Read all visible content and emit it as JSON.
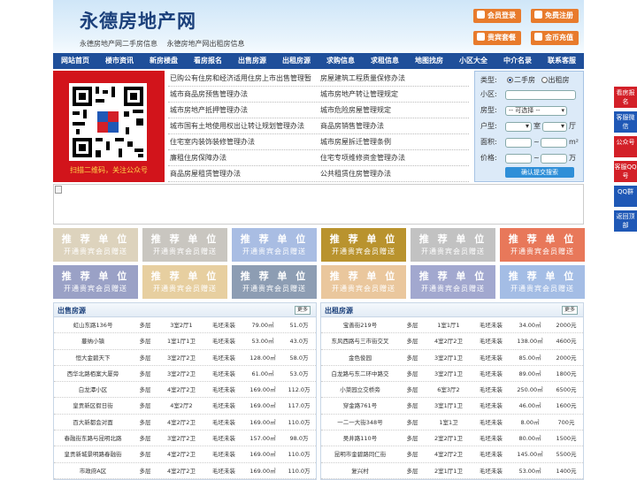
{
  "header": {
    "logo": "永德房地产网",
    "sub_links": [
      "永德房地产网二手房信息",
      "永德房地产网出租房信息"
    ],
    "buttons": [
      "会员登录",
      "免费注册",
      "贵宾套餐",
      "金币充值"
    ]
  },
  "nav": [
    "网站首页",
    "楼市资讯",
    "新房楼盘",
    "看房报名",
    "出售房源",
    "出租房源",
    "求购信息",
    "求租信息",
    "地图找房",
    "小区大全",
    "中介名录",
    "联系客服"
  ],
  "qr": {
    "caption": "扫描二维码，关注公众号"
  },
  "news_links": [
    [
      "已购公有住房和经济适用住房上市出售管理暂",
      "房屋建筑工程质量保修办法"
    ],
    [
      "城市商品房预售管理办法",
      "城市房地产转让管理规定"
    ],
    [
      "城市房地产抵押管理办法",
      "城市危险房屋管理规定"
    ],
    [
      "城市国有土地使用权出让转让规划管理办法",
      "商品房销售管理办法"
    ],
    [
      "住宅室内装饰装修管理办法",
      "城市房屋拆迁管理条例"
    ],
    [
      "廉租住房保障办法",
      "住宅专项维修资金管理办法"
    ],
    [
      "商品房屋租赁管理办法",
      "公共租赁住房管理办法"
    ]
  ],
  "search": {
    "type_label": "类型:",
    "type_opt1": "二手房",
    "type_opt2": "出租房",
    "community_label": "小区:",
    "house_label": "房型:",
    "house_select": "-- 可选择 --",
    "layout_label": "户型:",
    "room_unit": "室",
    "hall_unit": "厅",
    "area_label": "面积:",
    "area_sep": "~",
    "area_unit": "m²",
    "price_label": "价格:",
    "price_sep": "~",
    "price_unit": "万",
    "submit": "确认提交搜索"
  },
  "ads": {
    "line1": "推 荐 单 位",
    "line2": "开通贵宾会员赠送",
    "colors": [
      "#ddd3bd",
      "#c9c6c0",
      "#a9bde3",
      "#b9932e",
      "#c2c2c2",
      "#e8785a",
      "#9aa1c6",
      "#e7cfa0",
      "#8d9db3",
      "#eac79d",
      "#a2a8cf",
      "#a4bde5"
    ]
  },
  "sale": {
    "title": "出售房源",
    "more": "更多",
    "rows": [
      [
        "虹山东路136号",
        "多层",
        "3室2厅1",
        "毛坯未装",
        "79.00㎡",
        "51.0万"
      ],
      [
        "蔓纳小镇",
        "多层",
        "1室1厅1卫",
        "毛坯未装",
        "53.00㎡",
        "43.0万"
      ],
      [
        "恒大金碧天下",
        "多层",
        "3室2厅2卫",
        "毛坯未装",
        "128.00㎡",
        "58.0万"
      ],
      [
        "西华北路栢案大厦旁",
        "多层",
        "3室2厅2卫",
        "毛坯未装",
        "61.00㎡",
        "53.0万"
      ],
      [
        "白龙潭小区",
        "多层",
        "4室2厅2卫",
        "毛坯未装",
        "169.00㎡",
        "112.0万"
      ],
      [
        "皇贡新区假日街",
        "多层",
        "4室2厅2",
        "毛坯未装",
        "169.00㎡",
        "117.0万"
      ],
      [
        "百大新都会对面",
        "多层",
        "4室2厅2卫",
        "毛坯未装",
        "169.00㎡",
        "110.0万"
      ],
      [
        "春融街东路与昆明北路",
        "多层",
        "3室2厅2卫",
        "毛坯未装",
        "157.00㎡",
        "98.0万"
      ],
      [
        "皇贡新城景明路春融街",
        "多层",
        "4室2厅2卫",
        "毛坯未装",
        "169.00㎡",
        "110.0万"
      ],
      [
        "市政府A区",
        "多层",
        "4室2厅2卫",
        "毛坯未装",
        "169.00㎡",
        "110.0万"
      ]
    ]
  },
  "rent": {
    "title": "出租房源",
    "more": "更多",
    "rows": [
      [
        "宝善街219号",
        "多层",
        "1室1厅1",
        "毛坯未装",
        "34.00㎡",
        "2000元"
      ],
      [
        "东风西路与三市街交叉",
        "多层",
        "4室2厅2卫",
        "毛坯未装",
        "138.00㎡",
        "4600元"
      ],
      [
        "金色俊园",
        "多层",
        "3室2厅1卫",
        "毛坯未装",
        "85.00㎡",
        "2000元"
      ],
      [
        "白龙路与东二环中路交",
        "多层",
        "3室2厅1卫",
        "毛坯未装",
        "89.00㎡",
        "1800元"
      ],
      [
        "小菜园立交桥旁",
        "多层",
        "6室3厅2",
        "毛坯未装",
        "250.00㎡",
        "6500元"
      ],
      [
        "穿金路761号",
        "多层",
        "3室1厅1卫",
        "毛坯未装",
        "46.00㎡",
        "1600元"
      ],
      [
        "一二一大街348号",
        "多层",
        "1室1卫",
        "毛坯未装",
        "8.00㎡",
        "700元"
      ],
      [
        "吴井路110号",
        "多层",
        "2室2厅1卫",
        "毛坯未装",
        "80.00㎡",
        "1500元"
      ],
      [
        "昆明市金碧路同仁街",
        "多层",
        "4室2厅2卫",
        "毛坯未装",
        "145.00㎡",
        "5500元"
      ],
      [
        "复兴村",
        "多层",
        "2室1厅1卫",
        "毛坯未装",
        "53.00㎡",
        "1400元"
      ]
    ]
  },
  "side": [
    "看房报名",
    "客服微信",
    "公众号",
    "客服QQ号",
    "QQ群",
    "返回顶部"
  ]
}
